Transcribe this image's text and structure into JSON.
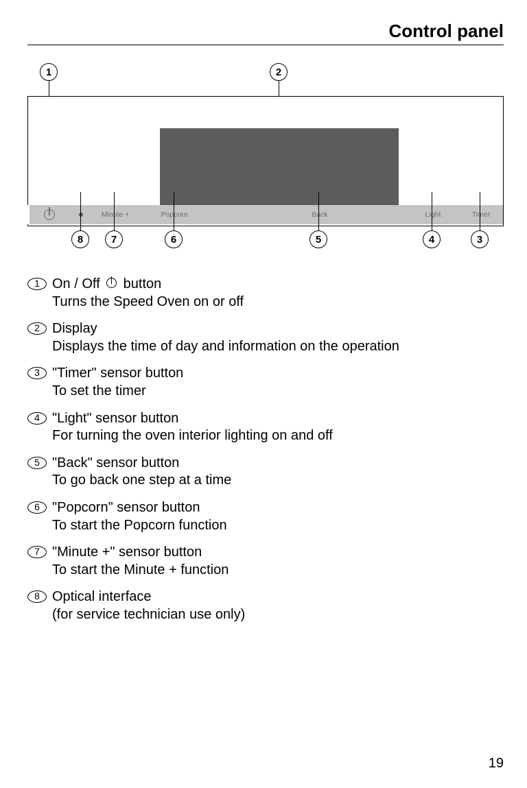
{
  "page_title": "Control panel",
  "page_number": "19",
  "panel_labels": {
    "minute_plus": "Minute +",
    "popcorn": "Popcorn",
    "back": "Back",
    "light": "Light",
    "timer": "Timer"
  },
  "callouts": {
    "c1": "1",
    "c2": "2",
    "c3": "3",
    "c4": "4",
    "c5": "5",
    "c6": "6",
    "c7": "7",
    "c8": "8"
  },
  "items": [
    {
      "num": "1",
      "title_pre": "On / Off",
      "title_post": "button",
      "sub": "Turns the Speed Oven on or off",
      "has_power_icon": true
    },
    {
      "num": "2",
      "title": "Display",
      "sub": "Displays the time of day and information on the operation"
    },
    {
      "num": "3",
      "title": "\"Timer\" sensor button",
      "sub": "To set the timer"
    },
    {
      "num": "4",
      "title": "\"Light\" sensor button",
      "sub": "For turning the oven interior lighting on and off"
    },
    {
      "num": "5",
      "title": "\"Back\" sensor button",
      "sub": "To go back one step at a time"
    },
    {
      "num": "6",
      "title": "\"Popcorn\" sensor button",
      "sub": "To start the Popcorn function"
    },
    {
      "num": "7",
      "title": "\"Minute +\" sensor button",
      "sub": "To start the Minute + function"
    },
    {
      "num": "8",
      "title": "Optical interface",
      "sub": "(for service technician use only)"
    }
  ]
}
